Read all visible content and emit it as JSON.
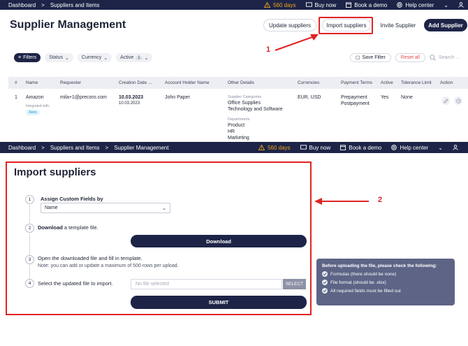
{
  "topbar": {
    "crumbs": [
      "Dashboard",
      "Suppliers and Items"
    ],
    "crumbs2": [
      "Dashboard",
      "Suppliers and Items",
      "Supplier Management"
    ],
    "sep": ">",
    "warning": "560 days",
    "buy_now": "Buy now",
    "book_demo": "Book a demo",
    "help_center": "Help center"
  },
  "page1": {
    "title": "Supplier Management",
    "buttons": {
      "update": "Update suppliers",
      "import": "Import suppliers",
      "invite": "Invite Supplier",
      "add": "Add Supplier"
    },
    "filters": {
      "filters": "Filters",
      "status": "Status",
      "currency": "Currency",
      "active": "Active",
      "active_count": "1",
      "save_filter": "Save Filter",
      "reset_all": "Reset all",
      "search_placeholder": "Search ..."
    },
    "table": {
      "headers": {
        "num": "#",
        "name": "Name",
        "requester": "Requester",
        "creation_date": "Creation Date ...",
        "account_holder": "Account Holder Name",
        "other_details": "Other Details",
        "currencies": "Currencies",
        "payment_terms": "Payment Terms",
        "active": "Active",
        "tolerance": "Tolerance Limit",
        "action": "Action"
      },
      "row": {
        "num": "1",
        "name": "Amazon",
        "integrated": "Integrated with:",
        "xero": "Xero",
        "requester": "mila+1@precoro.com",
        "date_bold": "10.03.2023",
        "date": "10.03.2023",
        "account_holder": "John Paper",
        "cat_header": "Supplier Categories",
        "cat1": "Office Supplies",
        "cat2": "Technology and Software",
        "dep_header": "Departments",
        "dep1": "Product",
        "dep2": "HR",
        "dep3": "Marketing",
        "currencies": "EUR, USD",
        "pay1": "Prepayment",
        "pay2": "Postpayment",
        "active": "Yes",
        "tolerance": "None"
      }
    }
  },
  "annotations": {
    "label1": "1",
    "label2": "2"
  },
  "import": {
    "title": "Import suppliers",
    "step1": {
      "num": "1",
      "label": "Assign Custom Fields by",
      "value": "Name"
    },
    "step2": {
      "num": "2",
      "label_bold": "Download",
      "label_rest": " a template file.",
      "button": "Download"
    },
    "step3": {
      "num": "3",
      "label": "Open the downloaded file and fill in template.",
      "note": "Note: you can add or update a maximum of 500 rows per upload."
    },
    "step4": {
      "num": "4",
      "label": "Select the updated file to import.",
      "placeholder": "No file selected",
      "select_button": "SELECT",
      "submit": "SUBMIT"
    }
  },
  "tooltip": {
    "title": "Before uploading the file, please check the following:",
    "items": [
      "Formulas (there should be none)",
      "File format (should be .xlsx)",
      "All required fields must be filled out"
    ]
  },
  "colors": {
    "navy": "#1d2447",
    "accent_red": "#e02424",
    "warning": "#f0a31c"
  }
}
